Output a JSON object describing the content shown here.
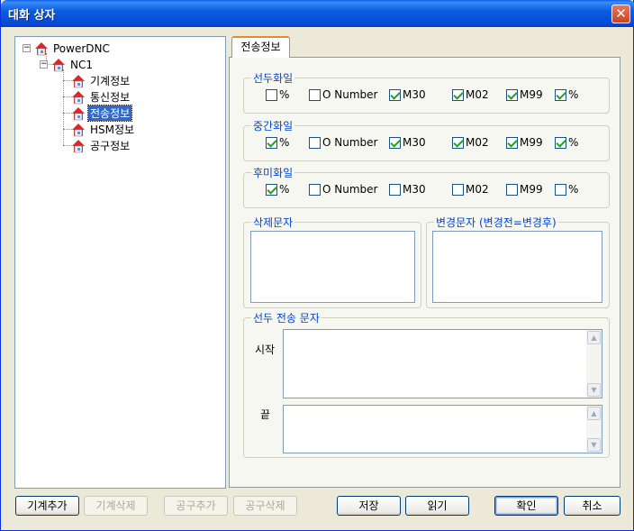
{
  "window": {
    "title": "대화 상자",
    "close_icon": "close-icon"
  },
  "tree": {
    "root": "PowerDNC",
    "nc": "NC1",
    "items": [
      "기계정보",
      "통신정보",
      "전송정보",
      "HSM정보",
      "공구정보"
    ],
    "selected_index": 2
  },
  "tab": {
    "label": "전송정보"
  },
  "groups": {
    "leading": {
      "title": "선두화일",
      "options": [
        {
          "label": "%",
          "checked": false
        },
        {
          "label": "O Number",
          "checked": false
        },
        {
          "label": "M30",
          "checked": true
        },
        {
          "label": "M02",
          "checked": true
        },
        {
          "label": "M99",
          "checked": true
        },
        {
          "label": "%",
          "checked": true
        }
      ]
    },
    "middle": {
      "title": "중간화일",
      "options": [
        {
          "label": "%",
          "checked": true
        },
        {
          "label": "O Number",
          "checked": false
        },
        {
          "label": "M30",
          "checked": true
        },
        {
          "label": "M02",
          "checked": true
        },
        {
          "label": "M99",
          "checked": true
        },
        {
          "label": "%",
          "checked": true
        }
      ]
    },
    "trailing": {
      "title": "후미화일",
      "options": [
        {
          "label": "%",
          "checked": true
        },
        {
          "label": "O Number",
          "checked": false
        },
        {
          "label": "M30",
          "checked": false
        },
        {
          "label": "M02",
          "checked": false
        },
        {
          "label": "M99",
          "checked": false
        },
        {
          "label": "%",
          "checked": false
        }
      ]
    },
    "delete_chars": {
      "title": "삭제문자",
      "value": ""
    },
    "replace_chars": {
      "title": "변경문자 (변경전=변경후)",
      "value": ""
    },
    "leading_transfer": {
      "title": "선두 전송 문자",
      "start_label": "시작",
      "start_value": "",
      "end_label": "끝",
      "end_value": ""
    }
  },
  "buttons": {
    "add_machine": "기계추가",
    "delete_machine": "기계삭제",
    "add_tool": "공구추가",
    "delete_tool": "공구삭제",
    "save": "저장",
    "read": "읽기",
    "ok": "확인",
    "cancel": "취소"
  }
}
